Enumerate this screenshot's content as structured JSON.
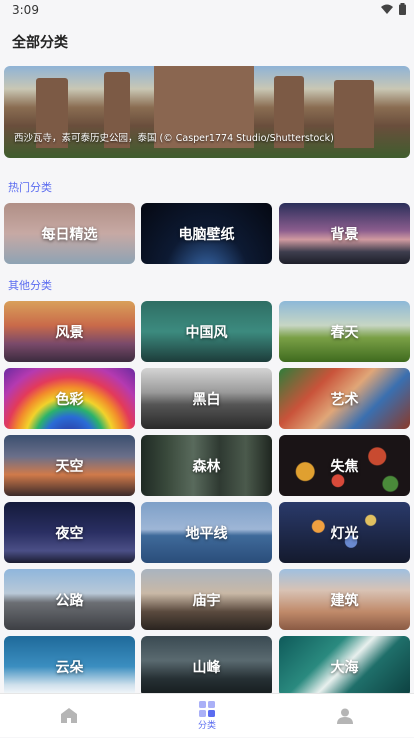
{
  "status": {
    "time": "3:09"
  },
  "header": {
    "title": "全部分类"
  },
  "banner": {
    "caption": "西沙瓦寺，素可泰历史公园，泰国 (© Casper1774 Studio/Shutterstock)"
  },
  "sections": {
    "hot": "热门分类",
    "other": "其他分类"
  },
  "hot_categories": [
    {
      "label": "每日精选",
      "bg": "linear-gradient(180deg,#b08f86,#c7a9a4 50%,#8ea3b4)"
    },
    {
      "label": "电脑壁纸",
      "bg": "radial-gradient(ellipse at 50% 120%,#3a6cb0 0%,#0d1a33 45%,#050812 100%)"
    },
    {
      "label": "背景",
      "bg": "linear-gradient(180deg,#2b2f5a 0%,#8b5d8e 45%,#d09aa0 60%,#3e3e4e 80%,#1e1f2a 100%)"
    }
  ],
  "other_categories": [
    {
      "label": "风景",
      "bg": "linear-gradient(180deg,#d9a05a 0%,#c96a4a 40%,#7a4a6a 70%,#3b2b3e 100%)"
    },
    {
      "label": "中国风",
      "bg": "linear-gradient(180deg,#2f6e64 0%,#3c8b7f 50%,#1d3c3a 100%)"
    },
    {
      "label": "春天",
      "bg": "linear-gradient(180deg,#8db8d8 0%,#c7d6c4 40%,#7aa046 60%,#3f6b1f 100%)"
    },
    {
      "label": "色彩",
      "bg": "radial-gradient(circle at 50% 120%,#2a2a8f 0%,#2a6bd6 25%,#2bb36a 35%,#f2d22b 45%,#f28b2b 55%,#e33a5a 65%,#b53ab0 80%,#6a2aa0 100%)"
    },
    {
      "label": "黑白",
      "bg": "linear-gradient(180deg,#d4d4d4 0%,#9a9a9a 40%,#555 60%,#2a2a2a 100%)"
    },
    {
      "label": "艺术",
      "bg": "linear-gradient(135deg,#2f7d3a 0%,#c9533a 30%,#e0a678 50%,#3a6fb0 70%,#8a3a2a 100%)"
    },
    {
      "label": "天空",
      "bg": "linear-gradient(180deg,#3b4f6f 0%,#6a6f8a 35%,#d07a4a 65%,#3a2a2a 100%)"
    },
    {
      "label": "森林",
      "bg": "linear-gradient(90deg,#1f2a24 0%,#3a4a3c 20%,#596a5c 40%,#2f3a32 60%,#4b5a4c 80%,#1f2620 100%)"
    },
    {
      "label": "失焦",
      "bg": "radial-gradient(circle at 20% 60%,#e0a030 0 8%,transparent 9%),radial-gradient(circle at 45% 75%,#d84a3a 0 7%,transparent 8%),radial-gradient(circle at 75% 35%,#c84a30 0 8%,transparent 9%),radial-gradient(circle at 85% 80%,#4a8a3a 0 6%,transparent 7%),#1a1416"
    },
    {
      "label": "夜空",
      "bg": "linear-gradient(180deg,#141a3a 0%,#2a2f63 50%,#4b4f86 80%,#1a1c30 100%)"
    },
    {
      "label": "地平线",
      "bg": "linear-gradient(180deg,#7ea0c8 0%,#9eb6d6 45%,#3f6a9a 55%,#2a4d7a 100%)"
    },
    {
      "label": "灯光",
      "bg": "radial-gradient(circle at 30% 40%,#f0a040 0 6%,transparent 7%),radial-gradient(circle at 70% 30%,#e0c060 0 5%,transparent 6%),radial-gradient(circle at 55% 65%,#6a8ad0 0 7%,transparent 8%),linear-gradient(180deg,#2a3a6a,#141a2e)"
    },
    {
      "label": "公路",
      "bg": "linear-gradient(180deg,#8fb6dc 0%,#b9c9d8 40%,#6c6f74 55%,#3d3f44 100%)"
    },
    {
      "label": "庙宇",
      "bg": "linear-gradient(180deg,#a9b4c0 0%,#c9b8a6 40%,#5a4a3e 70%,#2a2420 100%)"
    },
    {
      "label": "建筑",
      "bg": "linear-gradient(180deg,#9fc0e0 0%,#d8c2b4 35%,#c08a6a 70%,#8a5a44 100%)"
    },
    {
      "label": "云朵",
      "bg": "linear-gradient(180deg,#1f6a9a 0%,#3b8ec0 50%,#cfe0ec 80%,#ffffff 100%)"
    },
    {
      "label": "山峰",
      "bg": "linear-gradient(180deg,#3a4a52 0%,#5a6a70 40%,#263034 70%,#141a1c 100%)"
    },
    {
      "label": "大海",
      "bg": "linear-gradient(135deg,#0f5a5a 0%,#2a8a7f 35%,#e8f0ee 50%,#1f6f6a 65%,#0c3f3f 100%)"
    }
  ],
  "tabbar": {
    "tabs": [
      {
        "label": ""
      },
      {
        "label": "分类"
      },
      {
        "label": ""
      }
    ]
  },
  "colors": {
    "accent": "#5b6cf0",
    "icon_inactive": "#b5b5b5"
  }
}
